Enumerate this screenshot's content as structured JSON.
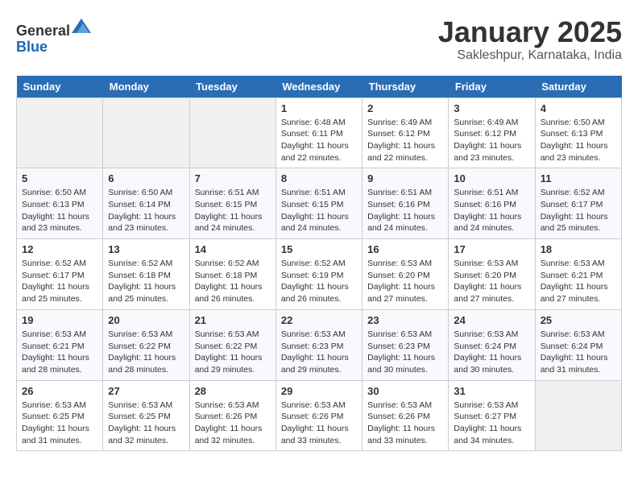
{
  "header": {
    "logo_line1": "General",
    "logo_line2": "Blue",
    "month": "January 2025",
    "location": "Sakleshpur, Karnataka, India"
  },
  "days_of_week": [
    "Sunday",
    "Monday",
    "Tuesday",
    "Wednesday",
    "Thursday",
    "Friday",
    "Saturday"
  ],
  "weeks": [
    [
      {
        "day": "",
        "empty": true
      },
      {
        "day": "",
        "empty": true
      },
      {
        "day": "",
        "empty": true
      },
      {
        "day": "1",
        "sunrise": "6:48 AM",
        "sunset": "6:11 PM",
        "daylight": "11 hours and 22 minutes."
      },
      {
        "day": "2",
        "sunrise": "6:49 AM",
        "sunset": "6:12 PM",
        "daylight": "11 hours and 22 minutes."
      },
      {
        "day": "3",
        "sunrise": "6:49 AM",
        "sunset": "6:12 PM",
        "daylight": "11 hours and 23 minutes."
      },
      {
        "day": "4",
        "sunrise": "6:50 AM",
        "sunset": "6:13 PM",
        "daylight": "11 hours and 23 minutes."
      }
    ],
    [
      {
        "day": "5",
        "sunrise": "6:50 AM",
        "sunset": "6:13 PM",
        "daylight": "11 hours and 23 minutes."
      },
      {
        "day": "6",
        "sunrise": "6:50 AM",
        "sunset": "6:14 PM",
        "daylight": "11 hours and 23 minutes."
      },
      {
        "day": "7",
        "sunrise": "6:51 AM",
        "sunset": "6:15 PM",
        "daylight": "11 hours and 24 minutes."
      },
      {
        "day": "8",
        "sunrise": "6:51 AM",
        "sunset": "6:15 PM",
        "daylight": "11 hours and 24 minutes."
      },
      {
        "day": "9",
        "sunrise": "6:51 AM",
        "sunset": "6:16 PM",
        "daylight": "11 hours and 24 minutes."
      },
      {
        "day": "10",
        "sunrise": "6:51 AM",
        "sunset": "6:16 PM",
        "daylight": "11 hours and 24 minutes."
      },
      {
        "day": "11",
        "sunrise": "6:52 AM",
        "sunset": "6:17 PM",
        "daylight": "11 hours and 25 minutes."
      }
    ],
    [
      {
        "day": "12",
        "sunrise": "6:52 AM",
        "sunset": "6:17 PM",
        "daylight": "11 hours and 25 minutes."
      },
      {
        "day": "13",
        "sunrise": "6:52 AM",
        "sunset": "6:18 PM",
        "daylight": "11 hours and 25 minutes."
      },
      {
        "day": "14",
        "sunrise": "6:52 AM",
        "sunset": "6:18 PM",
        "daylight": "11 hours and 26 minutes."
      },
      {
        "day": "15",
        "sunrise": "6:52 AM",
        "sunset": "6:19 PM",
        "daylight": "11 hours and 26 minutes."
      },
      {
        "day": "16",
        "sunrise": "6:53 AM",
        "sunset": "6:20 PM",
        "daylight": "11 hours and 27 minutes."
      },
      {
        "day": "17",
        "sunrise": "6:53 AM",
        "sunset": "6:20 PM",
        "daylight": "11 hours and 27 minutes."
      },
      {
        "day": "18",
        "sunrise": "6:53 AM",
        "sunset": "6:21 PM",
        "daylight": "11 hours and 27 minutes."
      }
    ],
    [
      {
        "day": "19",
        "sunrise": "6:53 AM",
        "sunset": "6:21 PM",
        "daylight": "11 hours and 28 minutes."
      },
      {
        "day": "20",
        "sunrise": "6:53 AM",
        "sunset": "6:22 PM",
        "daylight": "11 hours and 28 minutes."
      },
      {
        "day": "21",
        "sunrise": "6:53 AM",
        "sunset": "6:22 PM",
        "daylight": "11 hours and 29 minutes."
      },
      {
        "day": "22",
        "sunrise": "6:53 AM",
        "sunset": "6:23 PM",
        "daylight": "11 hours and 29 minutes."
      },
      {
        "day": "23",
        "sunrise": "6:53 AM",
        "sunset": "6:23 PM",
        "daylight": "11 hours and 30 minutes."
      },
      {
        "day": "24",
        "sunrise": "6:53 AM",
        "sunset": "6:24 PM",
        "daylight": "11 hours and 30 minutes."
      },
      {
        "day": "25",
        "sunrise": "6:53 AM",
        "sunset": "6:24 PM",
        "daylight": "11 hours and 31 minutes."
      }
    ],
    [
      {
        "day": "26",
        "sunrise": "6:53 AM",
        "sunset": "6:25 PM",
        "daylight": "11 hours and 31 minutes."
      },
      {
        "day": "27",
        "sunrise": "6:53 AM",
        "sunset": "6:25 PM",
        "daylight": "11 hours and 32 minutes."
      },
      {
        "day": "28",
        "sunrise": "6:53 AM",
        "sunset": "6:26 PM",
        "daylight": "11 hours and 32 minutes."
      },
      {
        "day": "29",
        "sunrise": "6:53 AM",
        "sunset": "6:26 PM",
        "daylight": "11 hours and 33 minutes."
      },
      {
        "day": "30",
        "sunrise": "6:53 AM",
        "sunset": "6:26 PM",
        "daylight": "11 hours and 33 minutes."
      },
      {
        "day": "31",
        "sunrise": "6:53 AM",
        "sunset": "6:27 PM",
        "daylight": "11 hours and 34 minutes."
      },
      {
        "day": "",
        "empty": true
      }
    ]
  ]
}
